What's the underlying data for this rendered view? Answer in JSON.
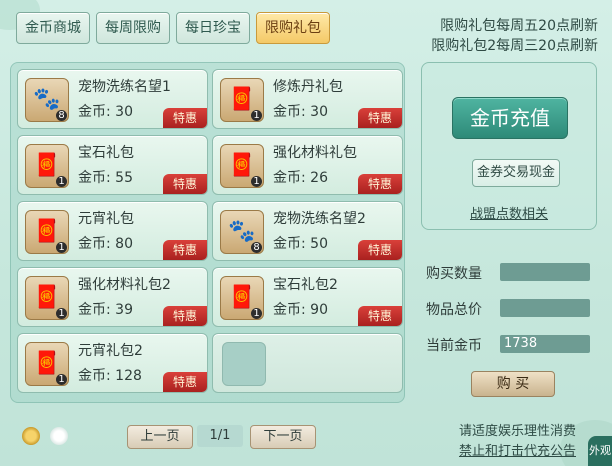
{
  "tabs": [
    "金币商城",
    "每周限购",
    "每日珍宝",
    "限购礼包"
  ],
  "active_tab": 3,
  "notice": {
    "line1": "限购礼包每周五20点刷新",
    "line2": "限购礼包2每周三20点刷新"
  },
  "price_prefix": "金币: ",
  "badge": "特惠",
  "items": [
    {
      "name": "宠物洗练名望1",
      "price": "30",
      "qty": "8",
      "icon": "paw-scroll-icon"
    },
    {
      "name": "修炼丹礼包",
      "price": "30",
      "qty": "1",
      "icon": "gift-bag-icon"
    },
    {
      "name": "宝石礼包",
      "price": "55",
      "qty": "1",
      "icon": "gift-bag-icon"
    },
    {
      "name": "强化材料礼包",
      "price": "26",
      "qty": "1",
      "icon": "gift-bag-icon"
    },
    {
      "name": "元宵礼包",
      "price": "80",
      "qty": "1",
      "icon": "gift-bag-icon"
    },
    {
      "name": "宠物洗练名望2",
      "price": "50",
      "qty": "8",
      "icon": "paw-scroll-icon"
    },
    {
      "name": "强化材料礼包2",
      "price": "39",
      "qty": "1",
      "icon": "gift-bag-icon"
    },
    {
      "name": "宝石礼包2",
      "price": "90",
      "qty": "1",
      "icon": "gift-bag-icon"
    },
    {
      "name": "元宵礼包2",
      "price": "128",
      "qty": "1",
      "icon": "gift-bag-icon"
    }
  ],
  "right_panel": {
    "recharge": "金币充值",
    "exchange": "金券交易现金",
    "alliance": "战盟点数相关"
  },
  "form": {
    "qty_label": "购买数量",
    "qty_value": "",
    "total_label": "物品总价",
    "total_value": "",
    "gold_label": "当前金币",
    "gold_value": "1738"
  },
  "buy": "购 买",
  "pager": {
    "prev": "上一页",
    "page": "1/1",
    "next": "下一页"
  },
  "footer": {
    "line1": "请适度娱乐理性消费",
    "line2": "禁止和打击代充公告"
  },
  "corner_label": "外观"
}
